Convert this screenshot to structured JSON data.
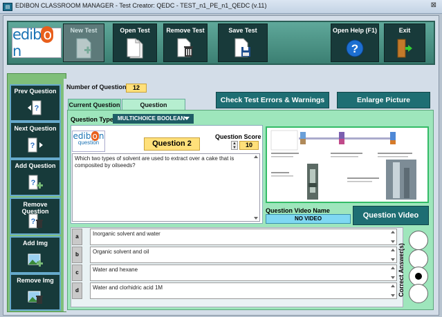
{
  "window": {
    "title": "EDIBON CLASSROOM MANAGER - Test Creator: QEDC - TEST_n1_PE_n1_QEDC (v.11)",
    "close_glyph": "⊠",
    "app_icon": "classroom-manager-icon"
  },
  "logo": {
    "pre": "edib",
    "mid": "o",
    "post": "n"
  },
  "toolbar": {
    "new_test": "New Test",
    "open_test": "Open Test",
    "remove_test": "Remove Test",
    "save_test": "Save Test",
    "open_help": "Open Help (F1)",
    "exit": "Exit"
  },
  "sidebar": {
    "prev_question": "Prev Question",
    "next_question": "Next Question",
    "add_question": "Add Question",
    "remove_question": "Remove Question",
    "add_img": "Add Img",
    "remove_img": "Remove Img"
  },
  "header": {
    "num_questions_label": "Number of Questions",
    "num_questions": "12",
    "check_errors": "Check Test Errors & Warnings",
    "enlarge_picture": "Enlarge Picture"
  },
  "tabs": {
    "current": "Current Question",
    "explanation": "Question Explanation"
  },
  "question": {
    "type_label": "Question Type",
    "type_value": "MULTICHOICE BOOLEAN",
    "small_logo_pre": "edib",
    "small_logo_mid": "o",
    "small_logo_post": "n",
    "small_logo_sub": "question",
    "number": "Question 2",
    "score_label": "Question Score",
    "score": "10",
    "text": "Which two types of solvent are used to extract over a cake that is composited by oilseeds?"
  },
  "video": {
    "name_label": "Question Video Name",
    "name_value": "NO VIDEO",
    "button": "Question Video"
  },
  "answers": [
    {
      "letter": "a",
      "text": "Inorganic solvent and water"
    },
    {
      "letter": "b",
      "text": "Organic solvent and oil"
    },
    {
      "letter": "c",
      "text": "Water and hexane"
    },
    {
      "letter": "d",
      "text": "Water and clorhidric acid 1M"
    }
  ],
  "correct_label": "Correct Answer(s)",
  "correct_index": 2
}
